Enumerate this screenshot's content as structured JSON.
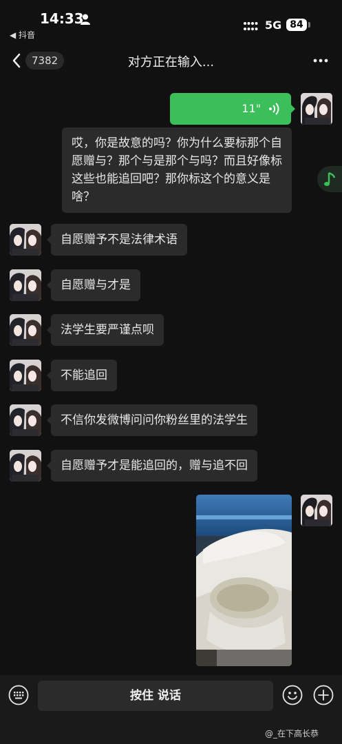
{
  "status_bar": {
    "time": "14:33",
    "back_app": "◀ 抖音",
    "network": "5G",
    "battery": "84"
  },
  "nav": {
    "unread_count": "7382",
    "title": "对方正在输入..."
  },
  "messages": {
    "voice_duration": "11\"",
    "self_text": "哎，你是故意的吗？你为什么要标那个自愿赠与？那个与是那个与吗？而且好像标这些也能追回吧？那你标这个的意义是啥？",
    "left": [
      "自愿赠予不是法律术语",
      "自愿赠与才是",
      "法学生要严谨点呗",
      "不能追回",
      "不信你发微博问问你粉丝里的法学生",
      "自愿赠予才是能追回的，赠与追不回"
    ]
  },
  "input_bar": {
    "hold_to_talk": "按住 说话"
  },
  "watermark": "@_在下高长恭",
  "colors": {
    "background": "#111111",
    "bubble_left": "#2b2b2b",
    "bubble_voice": "#3cbf5a",
    "bottom_bar": "#1a1a1a"
  },
  "icons": [
    "person-icon",
    "signal-icon",
    "back-chevron-icon",
    "more-icon",
    "voice-wave-icon",
    "music-note-icon",
    "keyboard-icon",
    "emoji-icon",
    "plus-icon"
  ]
}
